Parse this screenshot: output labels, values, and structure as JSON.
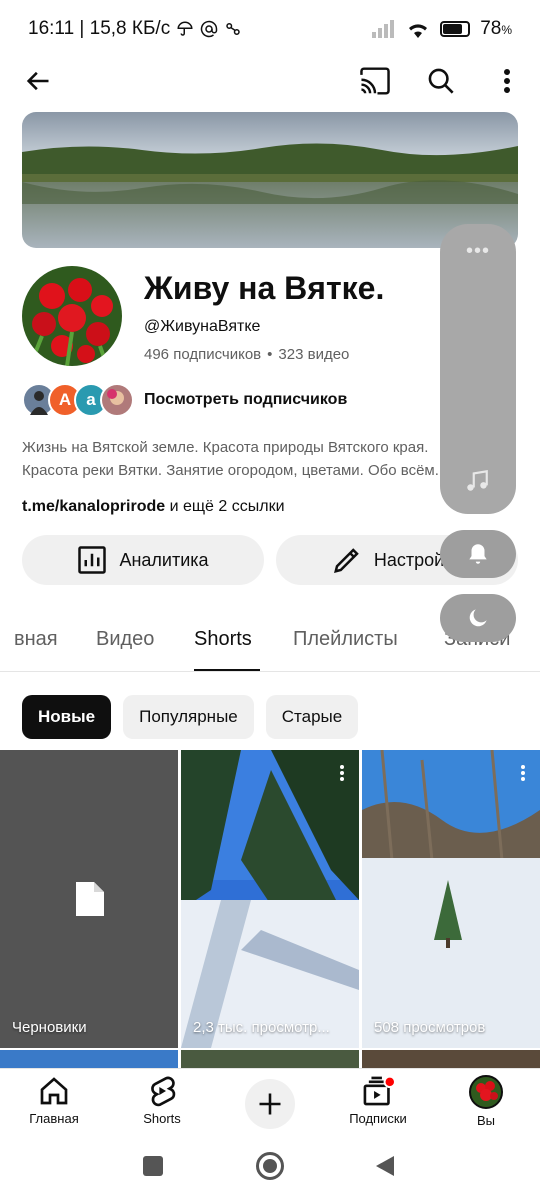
{
  "status_bar": {
    "time_speed": "16:11 | 15,8 КБ/с",
    "battery": "78",
    "battery_unit": "%",
    "battery_fraction": 0.78
  },
  "top_bar": {
    "icons": [
      "back-arrow-icon",
      "cast-icon",
      "search-icon",
      "more-vert-icon"
    ]
  },
  "channel": {
    "title": "Живу на Вятке.",
    "handle": "@ЖивунаВятке",
    "subscribers": "496 подписчиков",
    "separator": "•",
    "videos": "323 видео",
    "view_subscribers": "Посмотреть подписчиков",
    "subscriber_avatars": [
      {
        "letter": "",
        "color": "#6a7f9a"
      },
      {
        "letter": "А",
        "color": "#f0602a"
      },
      {
        "letter": "а",
        "color": "#2a9ab0"
      },
      {
        "letter": "",
        "color": "#b07a7a"
      }
    ],
    "description_line1": "Жизнь на Вятской земле. Красота природы Вятского края.",
    "description_line2": "Красота реки Вятки. Занятие огородом, цветами. Обо всём.",
    "link_text": "t.me/kanaloprirode",
    "link_more": " и ещё 2 ссылки"
  },
  "actions": {
    "analytics": "Аналитика",
    "settings": "Настройки"
  },
  "tabs": [
    {
      "label": "вная"
    },
    {
      "label": "Видео"
    },
    {
      "label": "Shorts"
    },
    {
      "label": "Плейлисты"
    },
    {
      "label": "Записи"
    }
  ],
  "chips": [
    {
      "label": "Новые"
    },
    {
      "label": "Популярные"
    },
    {
      "label": "Старые"
    }
  ],
  "grid": {
    "drafts_label": "Черновики",
    "items": [
      {
        "caption": "2,3 тыс. просмотр..."
      },
      {
        "caption": "508 просмотров"
      }
    ]
  },
  "bottom_nav": {
    "home": "Главная",
    "shorts": "Shorts",
    "subscriptions": "Подписки",
    "you": "Вы"
  },
  "colors": {
    "accent_red": "#ff0000",
    "chip_bg": "#f0f0f0",
    "text_secondary": "#606060"
  }
}
